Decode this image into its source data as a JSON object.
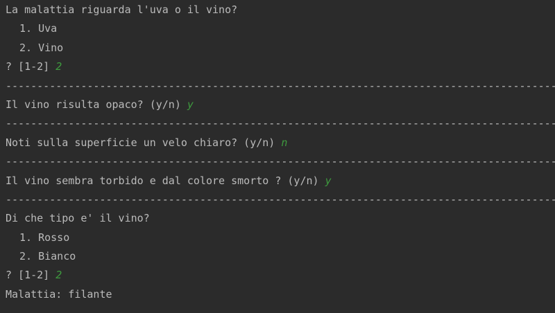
{
  "lines": [
    {
      "type": "text",
      "text": "La malattia riguarda l'uva o il vino?"
    },
    {
      "type": "option",
      "text": "1. Uva"
    },
    {
      "type": "option",
      "text": "2. Vino"
    },
    {
      "type": "prompt",
      "text": "? [1-2] ",
      "answer": "2"
    },
    {
      "type": "separator",
      "text": "--------------------------------------------------------------------------------------------"
    },
    {
      "type": "prompt",
      "text": "Il vino risulta opaco? (y/n) ",
      "answer": "y"
    },
    {
      "type": "separator",
      "text": "--------------------------------------------------------------------------------------------"
    },
    {
      "type": "prompt",
      "text": "Noti sulla superficie un velo chiaro? (y/n) ",
      "answer": "n"
    },
    {
      "type": "separator",
      "text": "--------------------------------------------------------------------------------------------"
    },
    {
      "type": "prompt",
      "text": "Il vino sembra torbido e dal colore smorto ? (y/n) ",
      "answer": "y"
    },
    {
      "type": "separator",
      "text": "--------------------------------------------------------------------------------------------"
    },
    {
      "type": "text",
      "text": "Di che tipo e' il vino?"
    },
    {
      "type": "option",
      "text": "1. Rosso"
    },
    {
      "type": "option",
      "text": "2. Bianco"
    },
    {
      "type": "prompt",
      "text": "? [1-2] ",
      "answer": "2"
    },
    {
      "type": "text",
      "text": "Malattia: filante"
    }
  ],
  "colors": {
    "background": "#2b2b2b",
    "text": "#bbbbbb",
    "answer": "#3e9a3e"
  }
}
